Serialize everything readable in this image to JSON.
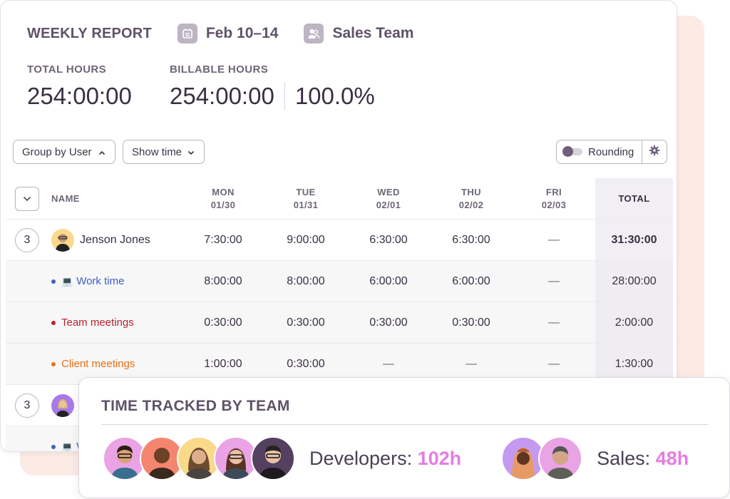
{
  "header": {
    "title": "WEEKLY REPORT",
    "date_range": "Feb 10–14",
    "team": "Sales Team",
    "icons": [
      "calendar-icon",
      "team-icon"
    ]
  },
  "stats": {
    "total_label": "TOTAL HOURS",
    "total_value": "254:00:00",
    "billable_label": "BILLABLE HOURS",
    "billable_value": "254:00:00",
    "billable_percent": "100.0%"
  },
  "toolbar": {
    "group_by_label": "Group by User",
    "show_time_label": "Show time",
    "rounding_label": "Rounding",
    "rounding_enabled": false
  },
  "table": {
    "name_header": "NAME",
    "total_header": "TOTAL",
    "days": [
      {
        "day": "MON",
        "date": "01/30"
      },
      {
        "day": "TUE",
        "date": "01/31"
      },
      {
        "day": "WED",
        "date": "02/01"
      },
      {
        "day": "THU",
        "date": "02/02"
      },
      {
        "day": "FRI",
        "date": "02/03"
      }
    ],
    "users": [
      {
        "count": "3",
        "name": "Jenson Jones",
        "values": [
          "7:30:00",
          "9:00:00",
          "6:30:00",
          "6:30:00",
          "—"
        ],
        "total": "31:30:00",
        "activities": [
          {
            "label": "Work time",
            "color": "#3f5fbf",
            "icon": "laptop-icon",
            "values": [
              "8:00:00",
              "8:00:00",
              "6:00:00",
              "6:00:00",
              "—"
            ],
            "total": "28:00:00"
          },
          {
            "label": "Team meetings",
            "color": "#b8232e",
            "values": [
              "0:30:00",
              "0:30:00",
              "0:30:00",
              "0:30:00",
              "—"
            ],
            "total": "2:00:00"
          },
          {
            "label": "Client meetings",
            "color": "#e86e12",
            "values": [
              "1:00:00",
              "0:30:00",
              "—",
              "—",
              "—"
            ],
            "total": "1:30:00"
          }
        ]
      },
      {
        "count": "3",
        "name": "",
        "activities": [
          {
            "label": "Work time",
            "color": "#3f5fbf",
            "icon": "laptop-icon"
          }
        ]
      }
    ]
  },
  "team_card": {
    "title": "TIME TRACKED BY TEAM",
    "teams": [
      {
        "label": "Developers:",
        "hours": "102h",
        "member_count": 5
      },
      {
        "label": "Sales:",
        "hours": "48h",
        "member_count": 2
      }
    ],
    "accent": "#e47de0"
  }
}
